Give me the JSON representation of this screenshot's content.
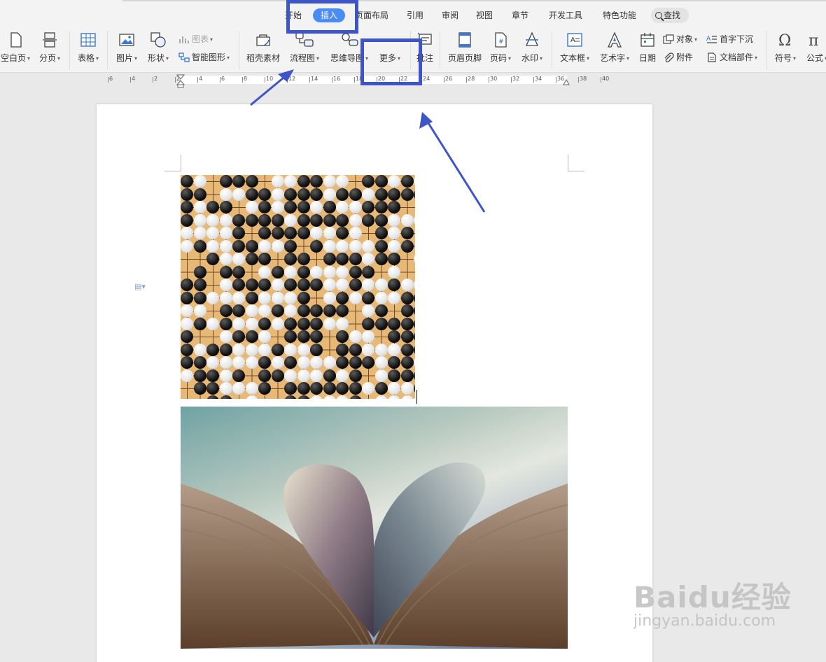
{
  "tabs": [
    {
      "label": "开始"
    },
    {
      "label": "插入",
      "active": true
    },
    {
      "label": "页面布局"
    },
    {
      "label": "引用"
    },
    {
      "label": "审阅"
    },
    {
      "label": "视图"
    },
    {
      "label": "章节"
    },
    {
      "label": "开发工具"
    },
    {
      "label": "特色功能"
    }
  ],
  "search": {
    "label": "查找"
  },
  "toolbar": {
    "blank_page": "空白页",
    "page_break": "分页",
    "table": "表格",
    "picture": "图片",
    "shape": "形状",
    "chart": "图表",
    "smart_graphic": "智能图形",
    "shell_material": "稻壳素材",
    "flowchart": "流程图",
    "mind_map": "思维导图",
    "more": "更多",
    "comment": "批注",
    "header_footer": "页眉页脚",
    "page_number": "页码",
    "watermark": "水印",
    "text_box": "文本框",
    "word_art": "艺术字",
    "date": "日期",
    "object": "对象",
    "attachment": "附件",
    "drop_cap": "首字下沉",
    "doc_parts": "文档部件",
    "symbol": "符号",
    "formula": "公式"
  },
  "ruler": {
    "labels": [
      "6",
      "4",
      "2",
      "2",
      "4",
      "6",
      "8",
      "10",
      "12",
      "14",
      "16",
      "18",
      "20",
      "22",
      "24",
      "26",
      "28",
      "30",
      "32",
      "34",
      "36",
      "38",
      "40"
    ]
  },
  "colors": {
    "accent": "#4b8bf4",
    "highlight": "#3d55c8"
  },
  "watermark": {
    "line1": "Baidu经验",
    "line2": "jingyan.baidu.com"
  }
}
